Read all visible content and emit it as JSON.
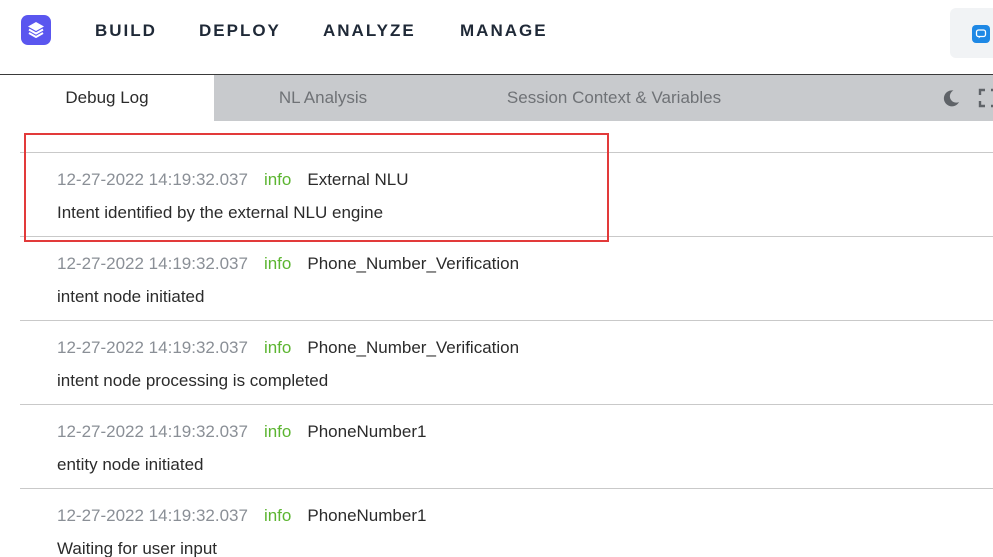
{
  "nav": {
    "items": [
      "BUILD",
      "DEPLOY",
      "ANALYZE",
      "MANAGE"
    ]
  },
  "tabs": {
    "debug_log": "Debug Log",
    "nl_analysis": "NL Analysis",
    "session_context": "Session Context & Variables"
  },
  "log": {
    "entries": [
      {
        "timestamp": "12-27-2022 14:19:32.037",
        "level": "info",
        "source": "External NLU",
        "message": "Intent identified by the external NLU engine"
      },
      {
        "timestamp": "12-27-2022 14:19:32.037",
        "level": "info",
        "source": "Phone_Number_Verification",
        "message": "intent node initiated"
      },
      {
        "timestamp": "12-27-2022 14:19:32.037",
        "level": "info",
        "source": "Phone_Number_Verification",
        "message": "intent node processing is completed"
      },
      {
        "timestamp": "12-27-2022 14:19:32.037",
        "level": "info",
        "source": "PhoneNumber1",
        "message": "entity node initiated"
      },
      {
        "timestamp": "12-27-2022 14:19:32.037",
        "level": "info",
        "source": "PhoneNumber1",
        "message": "Waiting for user input"
      }
    ]
  },
  "colors": {
    "brand": "#5a56ef",
    "info_level": "#5cb531",
    "highlight_border": "#e23a3a",
    "tab_bar": "#c8cacd"
  },
  "icons": {
    "logo": "layers-logo-icon",
    "chat": "chat-bubble-icon",
    "theme": "moon-icon",
    "expand": "expand-icon"
  }
}
